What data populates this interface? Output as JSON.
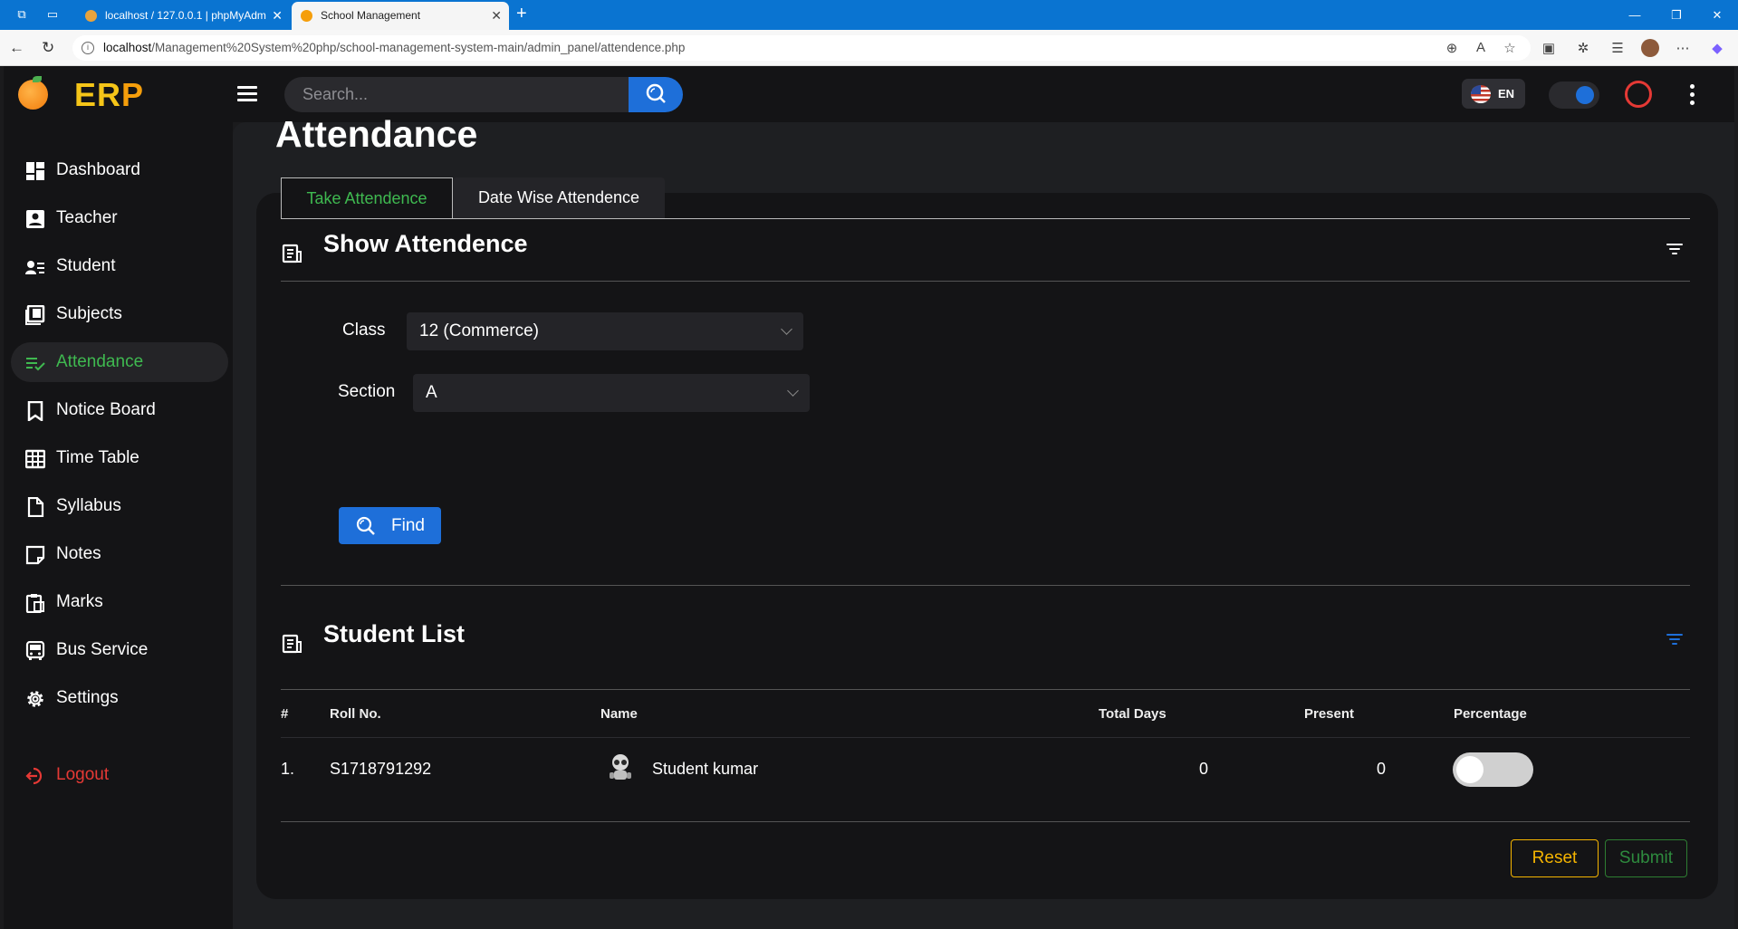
{
  "browser": {
    "tabs": [
      {
        "title": "localhost / 127.0.0.1 | phpMyAdm"
      },
      {
        "title": "School Management"
      }
    ],
    "url_host": "localhost",
    "url_path": "/Management%20System%20php/school-management-system-main/admin_panel/attendence.php"
  },
  "header": {
    "brand_main": "ER",
    "brand_accent": "P",
    "search_placeholder": "Search...",
    "language": "EN"
  },
  "sidebar": {
    "items": [
      {
        "label": "Dashboard",
        "icon": "dashboard-icon"
      },
      {
        "label": "Teacher",
        "icon": "teacher-icon"
      },
      {
        "label": "Student",
        "icon": "student-icon"
      },
      {
        "label": "Subjects",
        "icon": "subjects-icon"
      },
      {
        "label": "Attendance",
        "icon": "attendance-icon",
        "active": true
      },
      {
        "label": "Notice Board",
        "icon": "bookmark-icon"
      },
      {
        "label": "Time Table",
        "icon": "table-icon"
      },
      {
        "label": "Syllabus",
        "icon": "file-icon"
      },
      {
        "label": "Notes",
        "icon": "note-icon"
      },
      {
        "label": "Marks",
        "icon": "clipboard-icon"
      },
      {
        "label": "Bus Service",
        "icon": "bus-icon"
      },
      {
        "label": "Settings",
        "icon": "gear-icon"
      }
    ],
    "logout_label": "Logout"
  },
  "main": {
    "page_title": "Attendance",
    "tabs": [
      {
        "label": "Take Attendence",
        "active": true
      },
      {
        "label": "Date Wise Attendence",
        "active": false
      }
    ],
    "show_section_title": "Show Attendence",
    "class_label": "Class",
    "class_value": "12 (Commerce)",
    "section_label": "Section",
    "section_value": "A",
    "find_label": "Find",
    "student_list_title": "Student List",
    "table": {
      "headers": [
        "#",
        "Roll No.",
        "Name",
        "Total Days",
        "Present",
        "Percentage"
      ],
      "rows": [
        {
          "index": "1.",
          "roll": "S1718791292",
          "name": "Student kumar",
          "total_days": "0",
          "present": "0",
          "percentage_on": false
        }
      ]
    },
    "reset_label": "Reset",
    "submit_label": "Submit"
  },
  "colors": {
    "accent_blue": "#1e6fd9",
    "active_green": "#3fb950",
    "logout_red": "#e53935",
    "reset_yellow": "#f5b400"
  }
}
